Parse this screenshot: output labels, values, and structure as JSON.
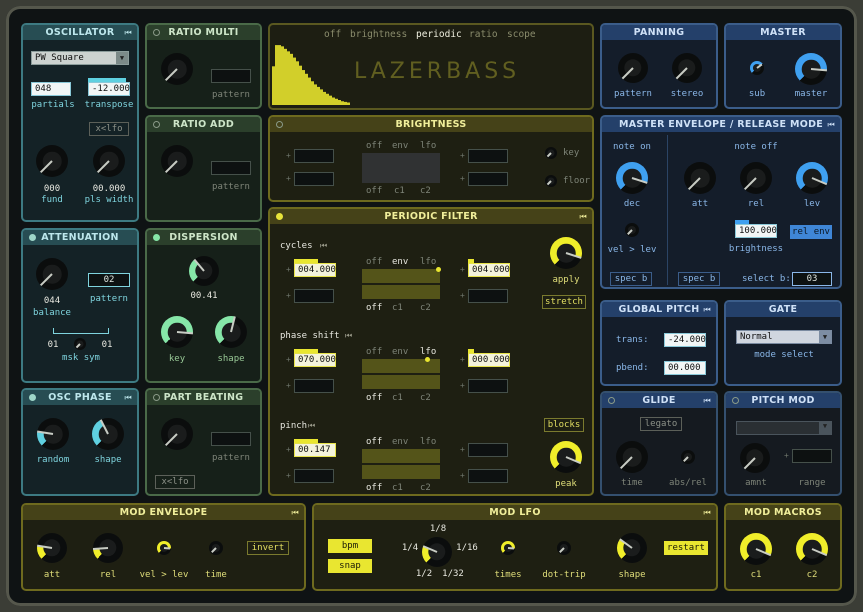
{
  "colors": {
    "cyan": "#3d7a82",
    "green": "#4a6a48",
    "yellow": "#e9e630",
    "blue": "#3b5d8a",
    "knob_cyan": "#5fd0e0",
    "knob_green": "#86e6a8",
    "knob_yellow": "#f0ee2a",
    "knob_blue": "#3fa0f0"
  },
  "oscillator": {
    "title": "OSCILLATOR",
    "waveform": "PW Square",
    "partials_value": "048",
    "partials_label": "partials",
    "transpose_value": "-12.000",
    "transpose_label": "transpose",
    "xlfo": "x<lfo",
    "fund_value": "000",
    "fund_label": "fund",
    "plswidth_value": "00.000",
    "plswidth_label": "pls width"
  },
  "ratio_multi": {
    "title": "RATIO MULTI",
    "pattern_label": "pattern"
  },
  "ratio_add": {
    "title": "RATIO ADD",
    "pattern_label": "pattern"
  },
  "attenuation": {
    "title": "ATTENUATION",
    "balance_value": "044",
    "balance_label": "balance",
    "pattern_value": "02",
    "pattern_label": "pattern",
    "msk_left": "01",
    "msk_right": "01",
    "msk_label": "msk sym"
  },
  "dispersion": {
    "title": "DISPERSION",
    "value": "00.41",
    "key_label": "key",
    "shape_label": "shape"
  },
  "osc_phase": {
    "title": "OSC PHASE",
    "random_label": "random",
    "shape_label": "shape"
  },
  "part_beating": {
    "title": "PART BEATING",
    "pattern_label": "pattern",
    "xlfo": "x<lfo"
  },
  "display": {
    "tabs": [
      "off",
      "brightness",
      "periodic",
      "ratio",
      "scope"
    ],
    "active_tab": "periodic",
    "title": "LAZERBASS",
    "bars": [
      0.62,
      0.96,
      0.96,
      0.94,
      0.9,
      0.86,
      0.82,
      0.76,
      0.7,
      0.63,
      0.56,
      0.5,
      0.44,
      0.38,
      0.33,
      0.29,
      0.25,
      0.21,
      0.18,
      0.15,
      0.12,
      0.1,
      0.08,
      0.06,
      0.05,
      0.04
    ]
  },
  "brightness": {
    "title": "BRIGHTNESS",
    "mod_top": [
      "off",
      "env",
      "lfo"
    ],
    "mod_bottom": [
      "off",
      "c1",
      "c2"
    ],
    "key_label": "key",
    "floor_label": "floor"
  },
  "periodic_filter": {
    "title": "PERIODIC FILTER",
    "apply_label": "apply",
    "stretch_label": "stretch",
    "blocks_label": "blocks",
    "peak_label": "peak",
    "rows": [
      {
        "name": "cycles",
        "left_value": "004.000",
        "right_value": "004.000",
        "mod_top": [
          "off",
          "env",
          "lfo"
        ],
        "mod_bottom": [
          "off",
          "c1",
          "c2"
        ],
        "active_top": "env",
        "active_bottom": "off"
      },
      {
        "name": "phase shift",
        "left_value": "070.000",
        "right_value": "000.000",
        "mod_top": [
          "off",
          "env",
          "lfo"
        ],
        "mod_bottom": [
          "off",
          "c1",
          "c2"
        ],
        "active_top": "lfo",
        "active_bottom": "off"
      },
      {
        "name": "pinch",
        "left_value": "00.147",
        "right_value": "",
        "mod_top": [
          "off",
          "env",
          "lfo"
        ],
        "mod_bottom": [
          "off",
          "c1",
          "c2"
        ],
        "active_top": "off",
        "active_bottom": "off"
      }
    ]
  },
  "panning": {
    "title": "PANNING",
    "pattern_label": "pattern",
    "stereo_label": "stereo"
  },
  "master": {
    "title": "MASTER",
    "sub_label": "sub",
    "master_label": "master"
  },
  "master_env": {
    "title": "MASTER ENVELOPE / RELEASE MODE",
    "note_on": "note on",
    "note_off": "note off",
    "dec_label": "dec",
    "vel_label": "vel > lev",
    "att_label": "att",
    "rel_label": "rel",
    "lev_label": "lev",
    "brightness_value": "100.000",
    "brightness_label": "brightness",
    "rel_env_label": "rel env",
    "spec_b1": "spec b",
    "spec_b2": "spec b",
    "select_b_label": "select b:",
    "select_b_value": "03"
  },
  "global_pitch": {
    "title": "GLOBAL PITCH",
    "trans_label": "trans:",
    "trans_value": "-24.000",
    "pbend_label": "pbend:",
    "pbend_value": "00.000"
  },
  "gate": {
    "title": "GATE",
    "mode": "Normal",
    "mode_label": "mode select"
  },
  "glide": {
    "title": "GLIDE",
    "legato_label": "legato",
    "time_label": "time",
    "absrel_label": "abs/rel"
  },
  "pitch_mod": {
    "title": "PITCH MOD",
    "amnt_label": "amnt",
    "range_label": "range"
  },
  "mod_envelope": {
    "title": "MOD ENVELOPE",
    "att_label": "att",
    "rel_label": "rel",
    "vel_label": "vel > lev",
    "time_label": "time",
    "invert_label": "invert"
  },
  "mod_lfo": {
    "title": "MOD LFO",
    "bpm_label": "bpm",
    "snap_label": "snap",
    "rates": {
      "top": "1/8",
      "left": "1/4",
      "right": "1/16",
      "bottom_left": "1/2",
      "bottom_right": "1/32"
    },
    "times_label": "times",
    "dottrip_label": "dot-trip",
    "shape_label": "shape",
    "restart_label": "restart"
  },
  "mod_macros": {
    "title": "MOD MACROS",
    "c1_label": "c1",
    "c2_label": "c2"
  }
}
